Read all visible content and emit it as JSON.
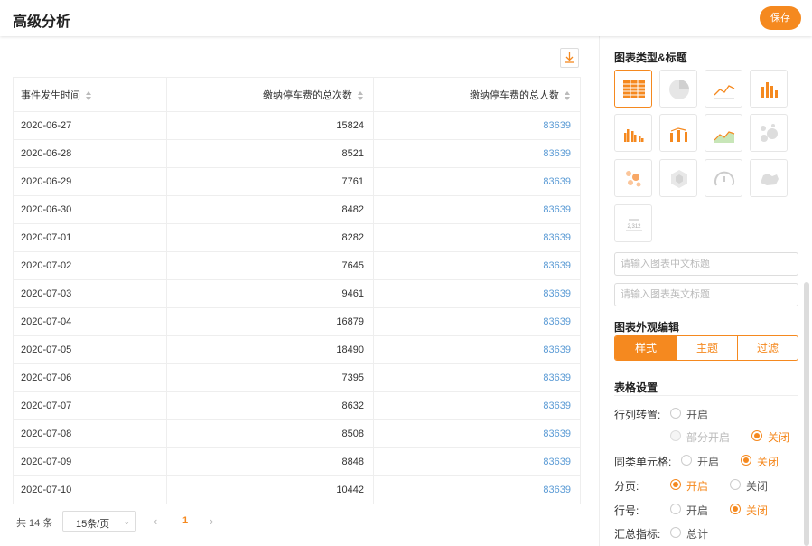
{
  "header": {
    "title": "高级分析",
    "save_label": "保存"
  },
  "table": {
    "columns": [
      "事件发生时间",
      "缴纳停车费的总次数",
      "缴纳停车费的总人数"
    ],
    "rows": [
      [
        "2020-06-27",
        "15824",
        "83639"
      ],
      [
        "2020-06-28",
        "8521",
        "83639"
      ],
      [
        "2020-06-29",
        "7761",
        "83639"
      ],
      [
        "2020-06-30",
        "8482",
        "83639"
      ],
      [
        "2020-07-01",
        "8282",
        "83639"
      ],
      [
        "2020-07-02",
        "7645",
        "83639"
      ],
      [
        "2020-07-03",
        "9461",
        "83639"
      ],
      [
        "2020-07-04",
        "16879",
        "83639"
      ],
      [
        "2020-07-05",
        "18490",
        "83639"
      ],
      [
        "2020-07-06",
        "7395",
        "83639"
      ],
      [
        "2020-07-07",
        "8632",
        "83639"
      ],
      [
        "2020-07-08",
        "8508",
        "83639"
      ],
      [
        "2020-07-09",
        "8848",
        "83639"
      ],
      [
        "2020-07-10",
        "10442",
        "83639"
      ]
    ]
  },
  "pagination": {
    "total": "共 14 条",
    "page_size": "15条/页",
    "current_page": "1"
  },
  "panel": {
    "chart_type_title": "图表类型&标题",
    "chart_types": [
      "table-icon",
      "pie-chart-icon",
      "line-chart-icon",
      "bar-chart-icon",
      "grouped-bar-chart-icon",
      "bar-line-chart-icon",
      "area-chart-icon",
      "bubble-chart-icon",
      "scatter-icon",
      "radar-icon",
      "gauge-icon",
      "map-icon",
      "number-card-icon"
    ],
    "cn_title_placeholder": "请输入图表中文标题",
    "en_title_placeholder": "请输入图表英文标题",
    "appearance_title": "图表外观编辑",
    "tabs": [
      "样式",
      "主题",
      "过滤"
    ],
    "table_settings_title": "表格设置",
    "transpose_label": "行列转置:",
    "same_cell_label": "同类单元格:",
    "paging_label": "分页:",
    "row_no_label": "行号:",
    "summary_label": "汇总指标:",
    "open": "开启",
    "partial_open": "部分开启",
    "close": "关闭",
    "total": "总计",
    "accent": "#f5891f"
  }
}
